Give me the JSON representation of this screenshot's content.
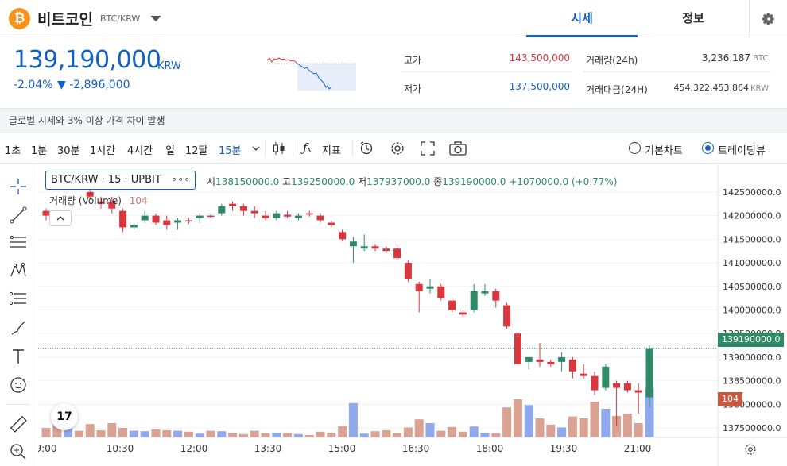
{
  "header": {
    "coin_symbol": "₿",
    "coin_name": "비트코인",
    "pair": "BTC/KRW",
    "tabs": [
      {
        "label": "시세",
        "active": true
      },
      {
        "label": "정보",
        "active": false
      }
    ]
  },
  "summary": {
    "price": "139,190,000",
    "unit": "KRW",
    "change_rate": "-2.04%",
    "change_amount": "▼ -2,896,000",
    "high_label": "고가",
    "high_value": "143,500,000",
    "low_label": "저가",
    "low_value": "137,500,000",
    "volume_label": "거래량(24h)",
    "volume_value": "3,236.187",
    "volume_unit": "BTC",
    "amount_label": "거래대금(24H)",
    "amount_value": "454,322,453,864",
    "amount_unit": "KRW"
  },
  "notice": "글로벌 시세와 3% 이상 가격 차이 발생",
  "toolbar": {
    "timeframes": [
      "1초",
      "1분",
      "30분",
      "1시간",
      "4시간",
      "일",
      "12달",
      "15분"
    ],
    "active_timeframe": "15분",
    "indicator_label": "지표",
    "view_basic": "기본차트",
    "view_tradingview": "트레이딩뷰",
    "selected_view": "트레이딩뷰"
  },
  "legend": {
    "symbol": "BTC/KRW · 15 · UPBIT",
    "more": "∘∘∘",
    "open_label": "시",
    "open": "138150000.0",
    "high_label": "고",
    "high": "139250000.0",
    "low_label": "저",
    "low": "137937000.0",
    "close_label": "종",
    "close": "139190000.0",
    "change": "+1070000.0 (+0.77%)",
    "volume_label": "거래량 (Volume)",
    "volume_value": "104"
  },
  "tv_logo": "17",
  "colors": {
    "up": "#2e8b66",
    "down": "#d9363e",
    "vol_up": "#8fa9ec",
    "vol_down": "#d9a293",
    "accent": "#1261c4"
  },
  "chart_data": {
    "type": "candlestick",
    "y_ticks": [
      "142500000.0",
      "142000000.0",
      "141500000.0",
      "141000000.0",
      "140500000.0",
      "140000000.0",
      "139500000.0",
      "139000000.0",
      "138500000.0",
      "138000000.0",
      "137500000.0"
    ],
    "x_ticks": [
      "9:00",
      "10:30",
      "12:00",
      "13:30",
      "15:00",
      "16:30",
      "18:00",
      "19:30",
      "21:00"
    ],
    "current_price_label": "139190000.0",
    "current_volume_label": "104",
    "ylim": [
      137300000,
      142750000
    ],
    "candles": [
      {
        "o": 142100000,
        "h": 142150000,
        "l": 141900000,
        "c": 142000000,
        "v": 20
      },
      {
        "o": 142650000,
        "h": 142750000,
        "l": 142550000,
        "c": 142600000,
        "v": 42
      },
      {
        "o": 142620000,
        "h": 142700000,
        "l": 142550000,
        "c": 142650000,
        "v": 28
      },
      {
        "o": 142650000,
        "h": 142700000,
        "l": 142580000,
        "c": 142600000,
        "v": 14
      },
      {
        "o": 142500000,
        "h": 142550000,
        "l": 142350000,
        "c": 142400000,
        "v": 28
      },
      {
        "o": 142300000,
        "h": 142400000,
        "l": 142150000,
        "c": 142250000,
        "v": 15
      },
      {
        "o": 142300000,
        "h": 142400000,
        "l": 142050000,
        "c": 142150000,
        "v": 30
      },
      {
        "o": 142100000,
        "h": 142150000,
        "l": 141650000,
        "c": 141750000,
        "v": 20
      },
      {
        "o": 141750000,
        "h": 141850000,
        "l": 141700000,
        "c": 141800000,
        "v": 14
      },
      {
        "o": 141900000,
        "h": 142100000,
        "l": 141850000,
        "c": 142000000,
        "v": 13
      },
      {
        "o": 142000000,
        "h": 142050000,
        "l": 141800000,
        "c": 141850000,
        "v": 17
      },
      {
        "o": 141900000,
        "h": 142000000,
        "l": 141700000,
        "c": 141800000,
        "v": 15
      },
      {
        "o": 141850000,
        "h": 141950000,
        "l": 141700000,
        "c": 141900000,
        "v": 14
      },
      {
        "o": 141900000,
        "h": 141950000,
        "l": 141830000,
        "c": 141880000,
        "v": 12
      },
      {
        "o": 141950000,
        "h": 142050000,
        "l": 141850000,
        "c": 142000000,
        "v": 8
      },
      {
        "o": 142000000,
        "h": 142020000,
        "l": 141950000,
        "c": 141980000,
        "v": 14
      },
      {
        "o": 142050000,
        "h": 142250000,
        "l": 142000000,
        "c": 142200000,
        "v": 13
      },
      {
        "o": 142250000,
        "h": 142300000,
        "l": 142100000,
        "c": 142200000,
        "v": 10
      },
      {
        "o": 142200000,
        "h": 142250000,
        "l": 142000000,
        "c": 142100000,
        "v": 7
      },
      {
        "o": 142100000,
        "h": 142200000,
        "l": 141950000,
        "c": 142050000,
        "v": 14
      },
      {
        "o": 142000000,
        "h": 142100000,
        "l": 141900000,
        "c": 141950000,
        "v": 9
      },
      {
        "o": 141950000,
        "h": 142100000,
        "l": 141900000,
        "c": 142050000,
        "v": 10
      },
      {
        "o": 142020000,
        "h": 142100000,
        "l": 141950000,
        "c": 141980000,
        "v": 9
      },
      {
        "o": 141950000,
        "h": 142050000,
        "l": 141900000,
        "c": 142000000,
        "v": 7
      },
      {
        "o": 142050000,
        "h": 142100000,
        "l": 141980000,
        "c": 142020000,
        "v": 5
      },
      {
        "o": 142000000,
        "h": 142050000,
        "l": 141850000,
        "c": 141900000,
        "v": 12
      },
      {
        "o": 141850000,
        "h": 141900000,
        "l": 141750000,
        "c": 141800000,
        "v": 10
      },
      {
        "o": 141650000,
        "h": 141700000,
        "l": 141450000,
        "c": 141500000,
        "v": 24
      },
      {
        "o": 141350000,
        "h": 141550000,
        "l": 141000000,
        "c": 141450000,
        "v": 72
      },
      {
        "o": 141300000,
        "h": 141600000,
        "l": 141250000,
        "c": 141350000,
        "v": 8
      },
      {
        "o": 141350000,
        "h": 141400000,
        "l": 141250000,
        "c": 141300000,
        "v": 13
      },
      {
        "o": 141300000,
        "h": 141350000,
        "l": 141200000,
        "c": 141250000,
        "v": 15
      },
      {
        "o": 141300000,
        "h": 141400000,
        "l": 141050000,
        "c": 141100000,
        "v": 9
      },
      {
        "o": 141000000,
        "h": 141050000,
        "l": 140600000,
        "c": 140650000,
        "v": 21
      },
      {
        "o": 140550000,
        "h": 140600000,
        "l": 139950000,
        "c": 140400000,
        "v": 38
      },
      {
        "o": 140450000,
        "h": 140650000,
        "l": 140350000,
        "c": 140500000,
        "v": 30
      },
      {
        "o": 140500000,
        "h": 140550000,
        "l": 140200000,
        "c": 140250000,
        "v": 14
      },
      {
        "o": 140200000,
        "h": 140250000,
        "l": 139950000,
        "c": 140000000,
        "v": 22
      },
      {
        "o": 139950000,
        "h": 140000000,
        "l": 139850000,
        "c": 139900000,
        "v": 12
      },
      {
        "o": 140000000,
        "h": 140550000,
        "l": 139950000,
        "c": 140400000,
        "v": 23
      },
      {
        "o": 140350000,
        "h": 140550000,
        "l": 140300000,
        "c": 140400000,
        "v": 10
      },
      {
        "o": 140400000,
        "h": 140450000,
        "l": 140050000,
        "c": 140200000,
        "v": 9
      },
      {
        "o": 140100000,
        "h": 140150000,
        "l": 139600000,
        "c": 139650000,
        "v": 63
      },
      {
        "o": 139500000,
        "h": 139550000,
        "l": 138850000,
        "c": 138850000,
        "v": 80
      },
      {
        "o": 138900000,
        "h": 139000000,
        "l": 138750000,
        "c": 139000000,
        "v": 68
      },
      {
        "o": 138950000,
        "h": 139300000,
        "l": 138800000,
        "c": 138900000,
        "v": 40
      },
      {
        "o": 138900000,
        "h": 138950000,
        "l": 138800000,
        "c": 138850000,
        "v": 27
      },
      {
        "o": 138900000,
        "h": 139100000,
        "l": 138700000,
        "c": 139000000,
        "v": 21
      },
      {
        "o": 138950000,
        "h": 139000000,
        "l": 138550000,
        "c": 138700000,
        "v": 44
      },
      {
        "o": 138650000,
        "h": 138850000,
        "l": 138550000,
        "c": 138600000,
        "v": 40
      },
      {
        "o": 138600000,
        "h": 138700000,
        "l": 138200000,
        "c": 138300000,
        "v": 75
      },
      {
        "o": 138350000,
        "h": 138850000,
        "l": 138300000,
        "c": 138800000,
        "v": 60
      },
      {
        "o": 138450000,
        "h": 138500000,
        "l": 137550000,
        "c": 138350000,
        "v": 45
      },
      {
        "o": 138450000,
        "h": 138500000,
        "l": 138250000,
        "c": 138300000,
        "v": 50
      },
      {
        "o": 138300000,
        "h": 138450000,
        "l": 137800000,
        "c": 138250000,
        "v": 30
      },
      {
        "o": 138150000,
        "h": 139250000,
        "l": 137937000,
        "c": 139190000,
        "v": 104
      }
    ],
    "volume_max": 110
  }
}
